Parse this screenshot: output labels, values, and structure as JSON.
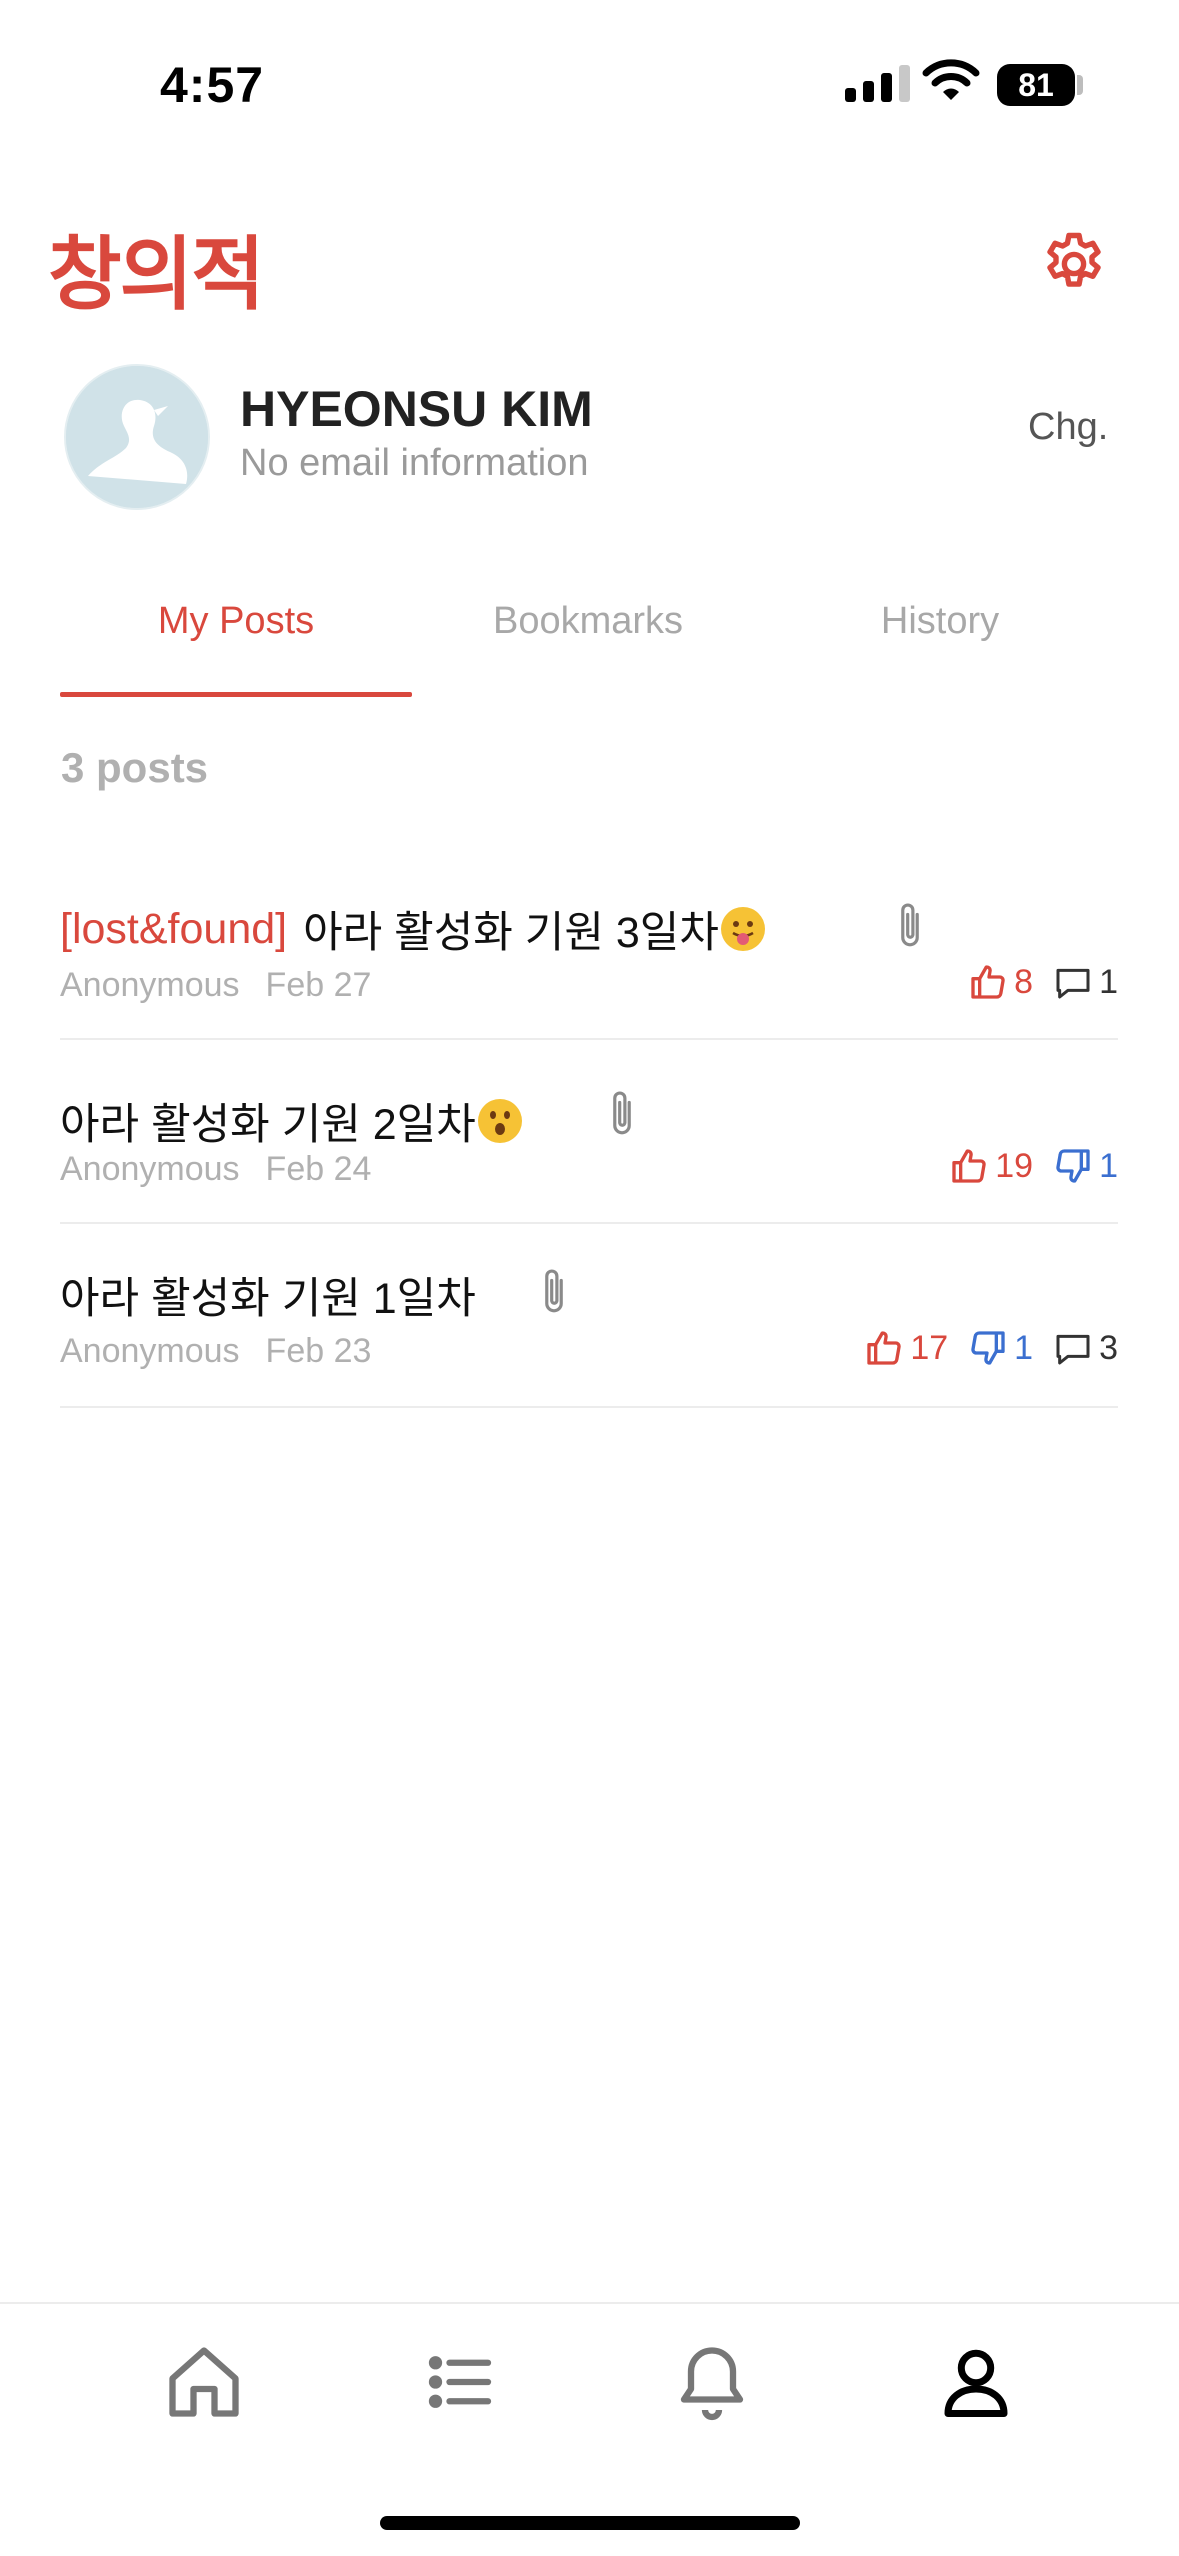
{
  "status_bar": {
    "time": "4:57",
    "battery": "81"
  },
  "header": {
    "logo": "창의적"
  },
  "profile": {
    "name": "HYEONSU KIM",
    "email": "No email information",
    "change_label": "Chg."
  },
  "tabs": [
    {
      "label": "My Posts",
      "active": true
    },
    {
      "label": "Bookmarks",
      "active": false
    },
    {
      "label": "History",
      "active": false
    }
  ],
  "post_count": "3 posts",
  "posts": [
    {
      "tag": "[lost&found]",
      "title": "아라 활성화 기원 3일차",
      "author": "Anonymous",
      "date": "Feb 27",
      "likes": "8",
      "comments": "1"
    },
    {
      "title": "아라 활성화 기원 2일차",
      "author": "Anonymous",
      "date": "Feb 24",
      "likes": "19",
      "dislikes": "1"
    },
    {
      "title": "아라 활성화 기원 1일차",
      "author": "Anonymous",
      "date": "Feb 23",
      "likes": "17",
      "dislikes": "1",
      "comments": "3"
    }
  ],
  "colors": {
    "accent": "#d9483d",
    "dislike": "#3b6fd0",
    "muted": "#b0b0b0"
  },
  "icons": [
    "gear-icon",
    "attachment-icon",
    "thumbs-up-icon",
    "thumbs-down-icon",
    "comment-icon",
    "home-icon",
    "list-icon",
    "bell-icon",
    "profile-icon"
  ]
}
